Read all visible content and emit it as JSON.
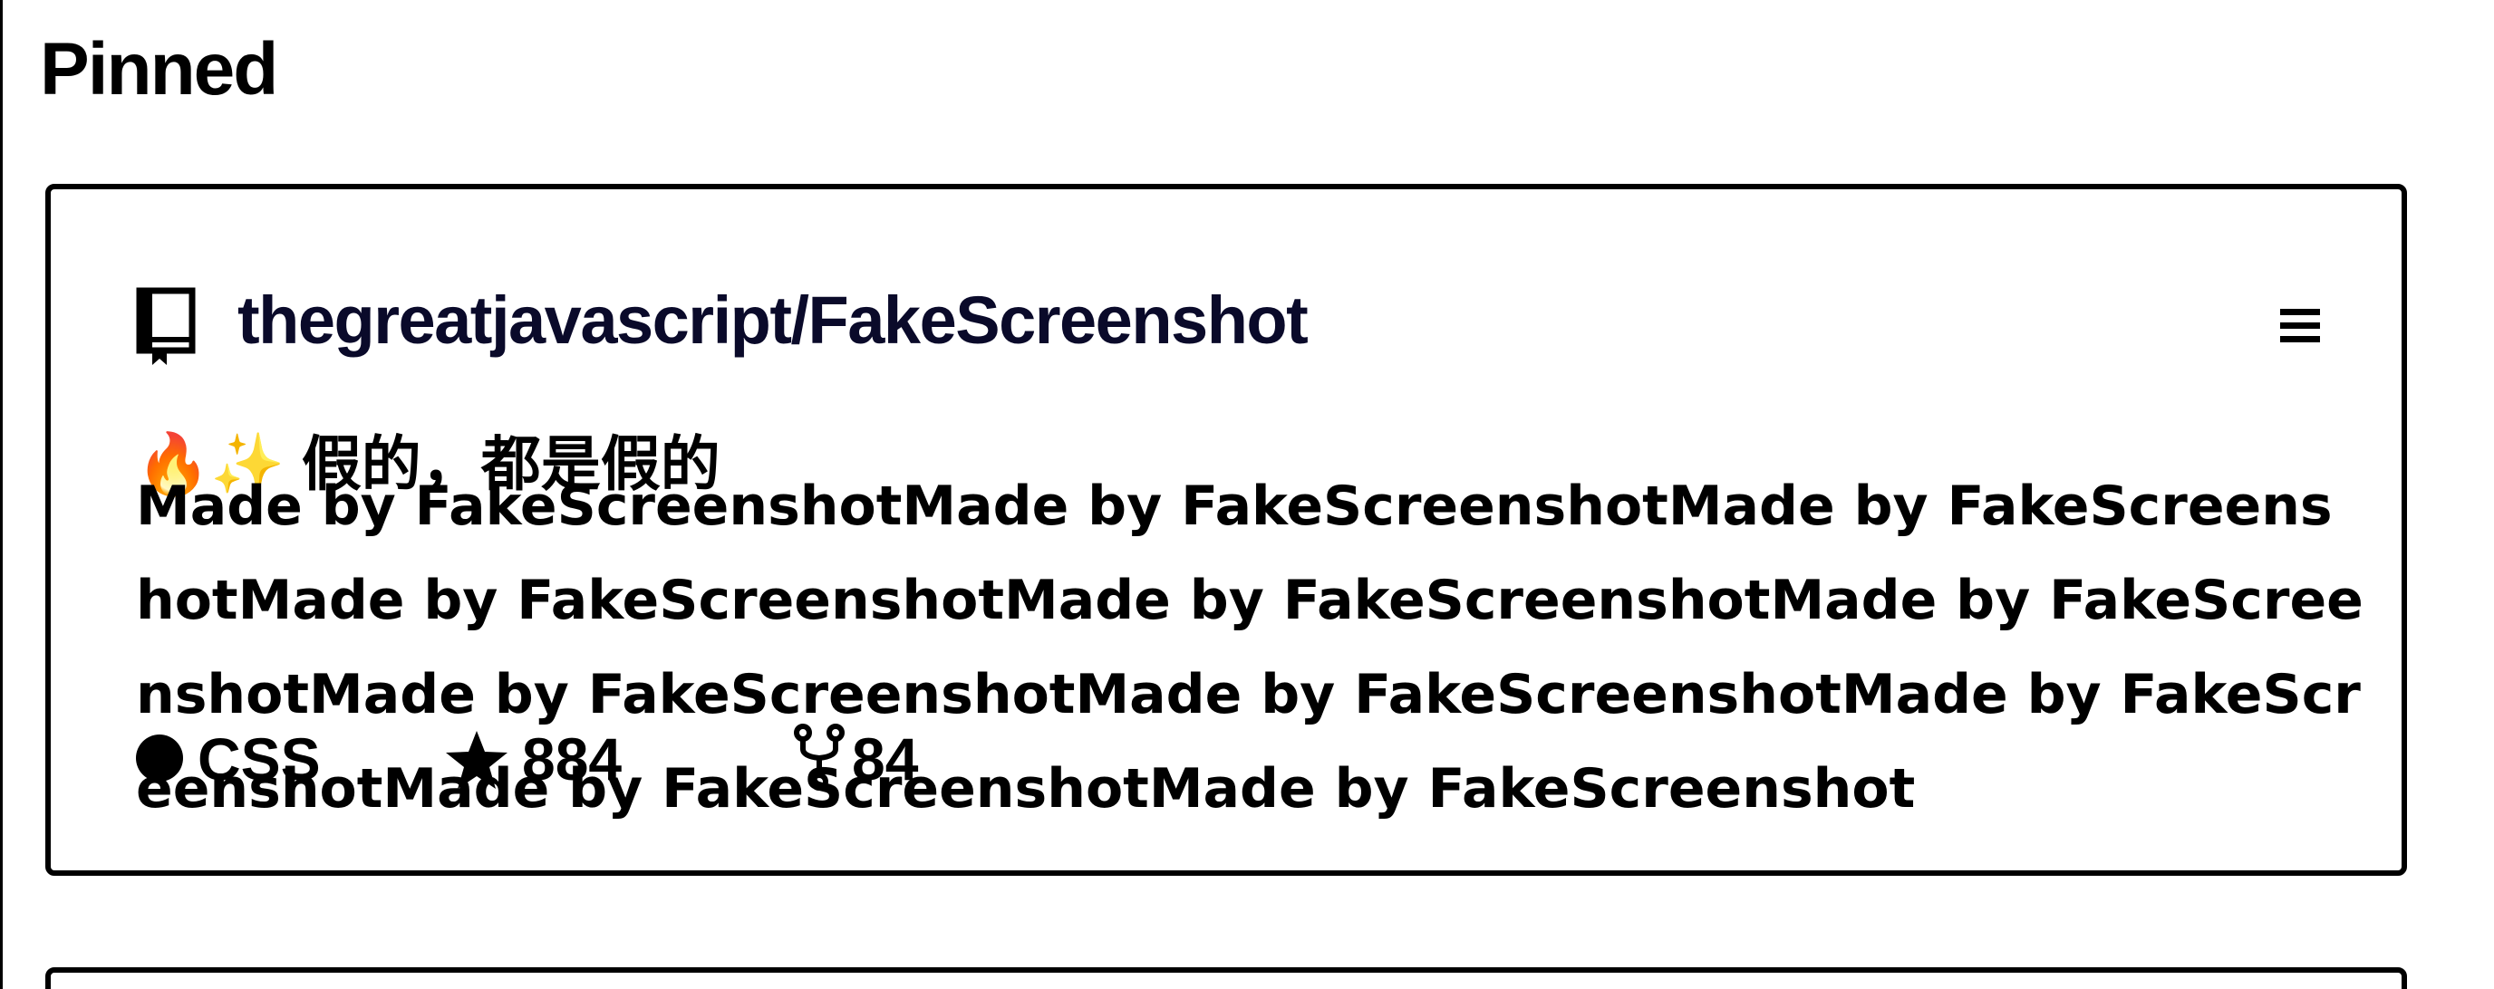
{
  "section": {
    "title": "Pinned"
  },
  "pinned": [
    {
      "repo_name": "thegreatjavascript/FakeScreenshot",
      "icons": {
        "repo": "repo-book-icon",
        "menu": "hamburger-menu-icon",
        "star": "star-icon",
        "fork": "fork-icon"
      },
      "description_short": "🔥✨ 假的，都是假的",
      "description_long": "Made by FakeScreenshotMade by FakeScreenshotMade by FakeScreenshotMade by FakeScreenshotMade by FakeScreenshotMade by FakeScreenshotMade by FakeScreenshotMade by FakeScreenshotMade by FakeScreenshotMade by FakeScreenshotMade by FakeScreenshot",
      "language": "CSS",
      "stars": "884",
      "forks": "84"
    }
  ],
  "colors": {
    "border": "#000000",
    "repo_name": "#0a0a2a",
    "background": "#ffffff"
  }
}
